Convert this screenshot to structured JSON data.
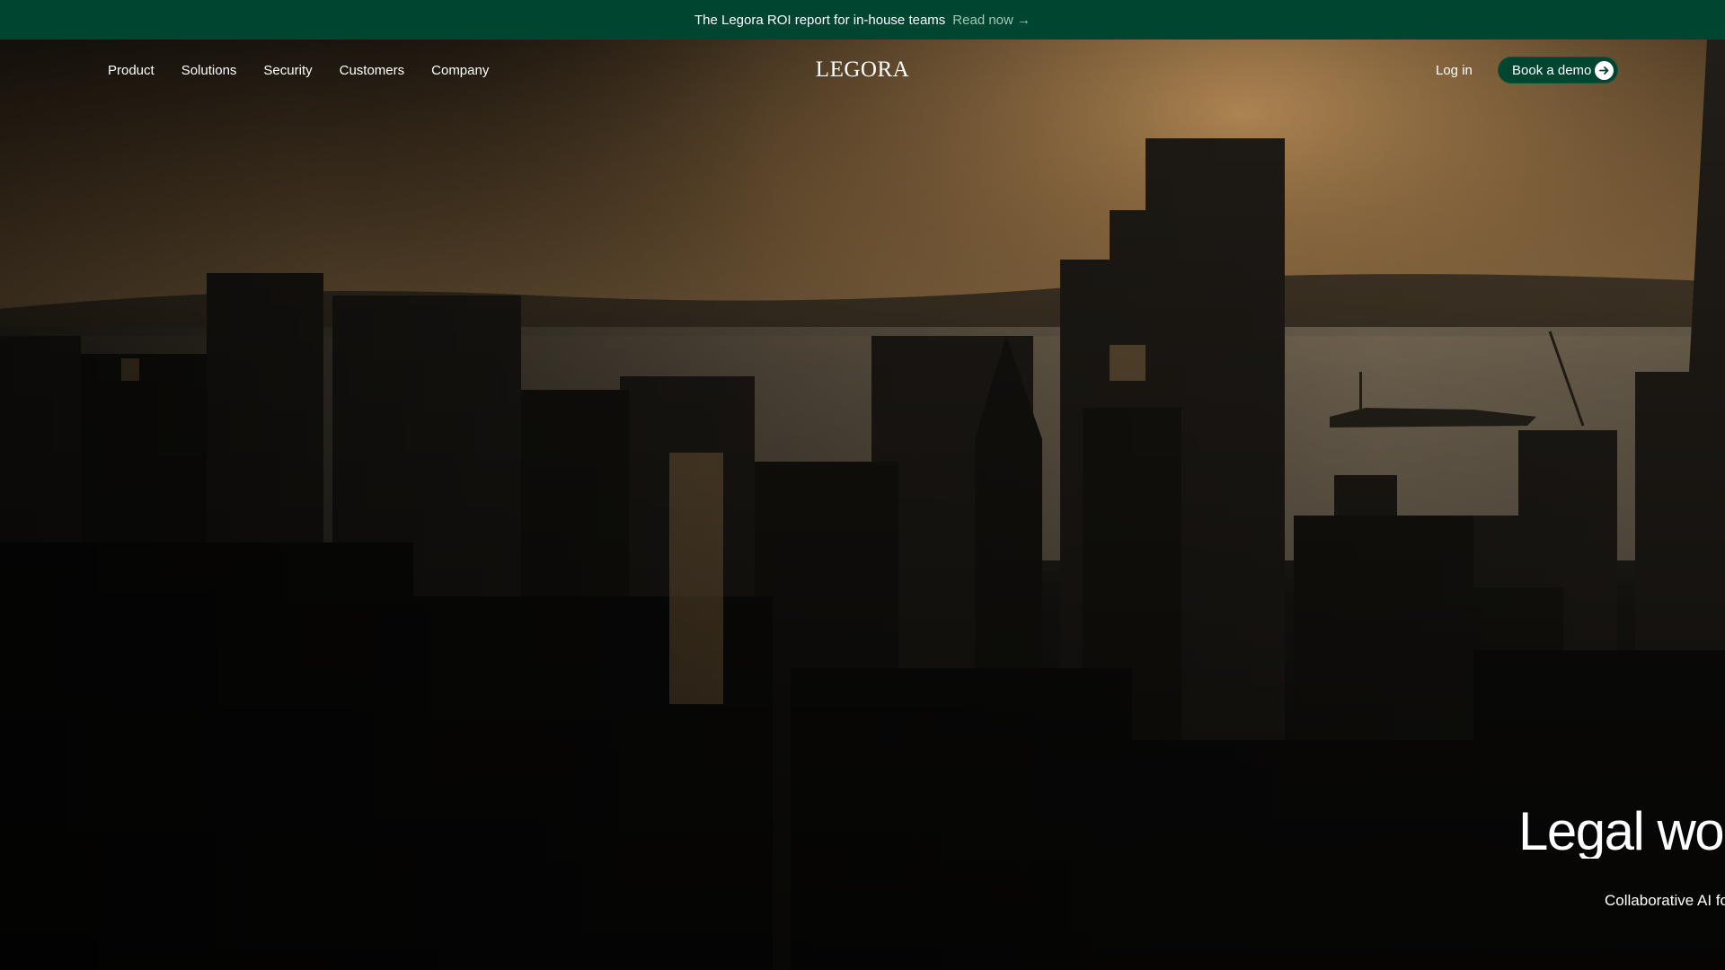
{
  "announcement": {
    "text": "The Legora ROI report for in-house teams",
    "link_label": "Read now →"
  },
  "nav": {
    "items": [
      {
        "label": "Product"
      },
      {
        "label": "Solutions"
      },
      {
        "label": "Security"
      },
      {
        "label": "Customers"
      },
      {
        "label": "Company"
      }
    ],
    "logo": "LEGORA",
    "login_label": "Log in",
    "cta_label": "Book a demo"
  },
  "hero": {
    "title": "Legal wor",
    "subtitle": "Collaborative AI for"
  },
  "colors": {
    "brand_green": "#00452f",
    "sky_glow": "#c9955a"
  }
}
